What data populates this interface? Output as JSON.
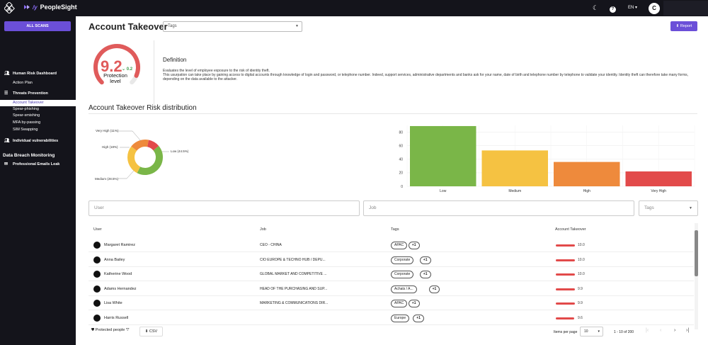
{
  "app": {
    "name": "PeopleSight",
    "lang": "EN",
    "avatar_initial": "C"
  },
  "sidebar": {
    "all_scans": "ALL SCANS",
    "items": [
      {
        "label": "Human Risk Dashboard",
        "kind": "head",
        "icon": "users-icon"
      },
      {
        "label": "Action Plan",
        "kind": "sub"
      },
      {
        "label": "Threats Prevention",
        "kind": "head",
        "icon": "list-icon"
      },
      {
        "label": "Account Takeover",
        "kind": "sub",
        "active": true
      },
      {
        "label": "Spear-phishing",
        "kind": "sub"
      },
      {
        "label": "Spear-smishing",
        "kind": "sub"
      },
      {
        "label": "MFA by-passing",
        "kind": "sub"
      },
      {
        "label": "SIM Swapping",
        "kind": "sub"
      },
      {
        "label": "Individual vulnerabilities",
        "kind": "head",
        "icon": "users-icon"
      }
    ],
    "section": "Data Breach Monitoring",
    "emails_leak": "Professional Emails Leak"
  },
  "header": {
    "title": "Account Takeover",
    "tags_placeholder": "Tags",
    "report": "Report"
  },
  "score": {
    "value": "9.2",
    "delta": "0.2",
    "label_line1": "Protection",
    "label_line2": "level",
    "fraction": 0.92
  },
  "definition": {
    "title": "Definition",
    "line1": "Evaluates the level of employee exposure to the risk of identity theft.",
    "line2": "This usurpation can take place by gaining access to digital accounts through knowledge of login and password, or telephone number. Indeed, support services, administrative departments and banks ask for your name, date of birth and telephone number by telephone to validate your identity. Identity theft can therefore take many forms, depending on the data available to the attacker."
  },
  "distribution": {
    "title": "Account Takeover Risk distribution"
  },
  "chart_data": [
    {
      "type": "pie",
      "labels": [
        "Low (44.5%)",
        "Medium (28.5%)",
        "High (18%)",
        "Very High (11%)"
      ],
      "values": [
        44.5,
        28.5,
        18,
        11
      ],
      "colors": [
        "#7ab648",
        "#f5c242",
        "#ee8a3c",
        "#e24a4a"
      ]
    },
    {
      "type": "bar",
      "categories": [
        "Low",
        "Medium",
        "High",
        "Very High"
      ],
      "values": [
        89,
        53,
        36,
        22
      ],
      "colors": [
        "#7ab648",
        "#f5c242",
        "#ee8a3c",
        "#e24a4a"
      ],
      "ylim": [
        0,
        90
      ],
      "yticks": [
        0,
        20,
        40,
        60,
        80
      ]
    }
  ],
  "filters": {
    "user": "User",
    "job": "Job",
    "tags": "Tags"
  },
  "table": {
    "headers": [
      "User",
      "Job",
      "Tags",
      "Account Takeover"
    ],
    "rows": [
      {
        "name": "Margaret Ramirez",
        "job": "CEO - CHINA",
        "tag": "APAC",
        "more": "+1",
        "score": "10.0",
        "bar": 1.0
      },
      {
        "name": "Anna Bailey",
        "job": "CIO EUROPE & TECHNO HUB / DEPU...",
        "tag": "Corporate",
        "more": "+1",
        "score": "10.0",
        "bar": 1.0
      },
      {
        "name": "Katherine Wood",
        "job": "GLOBAL MARKET AND COMPETITIVE ...",
        "tag": "Corporate",
        "more": "+1",
        "score": "10.0",
        "bar": 1.0
      },
      {
        "name": "Adams Hernandez",
        "job": "HEAD OF THE PURCHASING AND SUP...",
        "tag": "Achats / A...",
        "more": "+1",
        "score": "9.9",
        "bar": 0.99
      },
      {
        "name": "Lisa White",
        "job": "MARKETING & COMMUNICATIONS DIR...",
        "tag": "APAC",
        "more": "+1",
        "score": "9.9",
        "bar": 0.99
      },
      {
        "name": "Harris Russell",
        "job": "",
        "tag": "Europe",
        "more": "+1",
        "score": "9.6",
        "bar": 0.96
      }
    ]
  },
  "footer": {
    "protected": "Protected people",
    "csv": "CSV",
    "items_per_page": "Items per page",
    "page_size": "10",
    "range": "1 - 10 of 200"
  }
}
